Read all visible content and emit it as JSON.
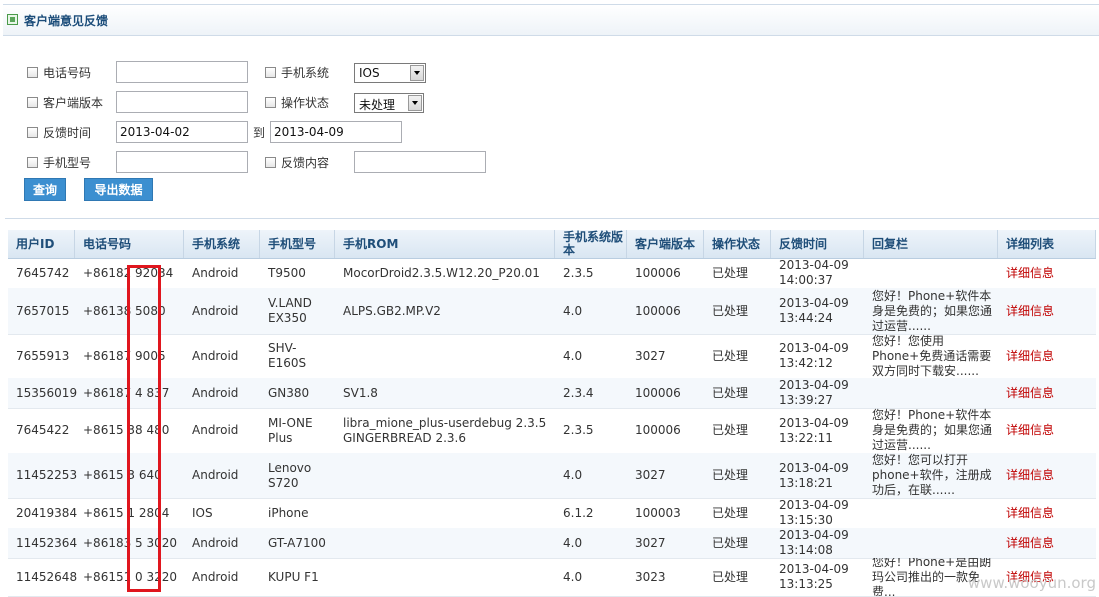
{
  "page": {
    "title": "客户端意见反馈"
  },
  "filters": {
    "phone_label": "电话号码",
    "phone_value": "",
    "os_label": "手机系统",
    "os_value": "IOS",
    "client_version_label": "客户端版本",
    "client_version_value": "",
    "status_label": "操作状态",
    "status_value": "未处理",
    "feedback_time_label": "反馈时间",
    "date_from": "2013-04-02",
    "date_to_label": "到",
    "date_to": "2013-04-09",
    "model_label": "手机型号",
    "model_value": "",
    "content_label": "反馈内容",
    "content_value": "",
    "query_button": "查询",
    "export_button": "导出数据"
  },
  "table": {
    "headers": [
      "用户ID",
      "电话号码",
      "手机系统",
      "手机型号",
      "手机ROM",
      "手机系统版本",
      "客户端版本",
      "操作状态",
      "反馈时间",
      "回复栏",
      "详细列表"
    ],
    "rows": [
      {
        "uid": "7645742",
        "phone": "+86182   92034",
        "os": "Android",
        "model": "T9500",
        "rom": "MocorDroid2.3.5.W12.20_P20.01",
        "osver": "2.3.5",
        "clientver": "100006",
        "status": "已处理",
        "time": "2013-04-09 14:00:37",
        "reply": "",
        "detail": "详细信息"
      },
      {
        "uid": "7657015",
        "phone": "+86138    5080",
        "os": "Android",
        "model": "V.LAND EX350",
        "rom": "ALPS.GB2.MP.V2",
        "osver": "4.0",
        "clientver": "100006",
        "status": "已处理",
        "time": "2013-04-09 13:44:24",
        "reply": "您好！Phone+软件本身是免费的；如果您通过运营......",
        "detail": "详细信息"
      },
      {
        "uid": "7655913",
        "phone": "+86187   9005",
        "os": "Android",
        "model": "SHV-E160S",
        "rom": "",
        "osver": "4.0",
        "clientver": "3027",
        "status": "已处理",
        "time": "2013-04-09 13:42:12",
        "reply": "您好！您使用Phone+免费通话需要双方同时下载安......",
        "detail": "详细信息"
      },
      {
        "uid": "15356019",
        "phone": "+86187  4  837",
        "os": "Android",
        "model": "GN380",
        "rom": "SV1.8",
        "osver": "2.3.4",
        "clientver": "100006",
        "status": "已处理",
        "time": "2013-04-09 13:39:27",
        "reply": "",
        "detail": "详细信息"
      },
      {
        "uid": "7645422",
        "phone": "+8615  38  480",
        "os": "Android",
        "model": "MI-ONE Plus",
        "rom": "libra_mione_plus-userdebug 2.3.5 GINGERBREAD 2.3.6",
        "osver": "2.3.5",
        "clientver": "100006",
        "status": "已处理",
        "time": "2013-04-09 13:22:11",
        "reply": "您好！Phone+软件本身是免费的；如果您通过运营......",
        "detail": "详细信息"
      },
      {
        "uid": "11452253",
        "phone": "+8615   3   640",
        "os": "Android",
        "model": "Lenovo S720",
        "rom": "",
        "osver": "4.0",
        "clientver": "3027",
        "status": "已处理",
        "time": "2013-04-09 13:18:21",
        "reply": "您好！您可以打开phone+软件，注册成功后，在联......",
        "detail": "详细信息"
      },
      {
        "uid": "20419384",
        "phone": "+8615    1  2804",
        "os": "IOS",
        "model": "iPhone",
        "rom": "",
        "osver": "6.1.2",
        "clientver": "100003",
        "status": "已处理",
        "time": "2013-04-09 13:15:30",
        "reply": "",
        "detail": "详细信息"
      },
      {
        "uid": "11452364",
        "phone": "+86183   5  3020",
        "os": "Android",
        "model": "GT-A7100",
        "rom": "",
        "osver": "4.0",
        "clientver": "3027",
        "status": "已处理",
        "time": "2013-04-09 13:14:08",
        "reply": "",
        "detail": "详细信息"
      },
      {
        "uid": "11452648",
        "phone": "+86151   0  3220",
        "os": "Android",
        "model": "KUPU F1",
        "rom": "",
        "osver": "4.0",
        "clientver": "3023",
        "status": "已处理",
        "time": "2013-04-09 13:13:25",
        "reply": "您好！Phone+是由朗玛公司推出的一款免费...",
        "detail": "详细信息"
      }
    ]
  },
  "watermark": "www.wooyun.org",
  "colors": {
    "header_text": "#1f4e79",
    "button_bg": "#3c8fd0",
    "detail_link": "#c00000",
    "highlight_box": "#e0161e"
  }
}
